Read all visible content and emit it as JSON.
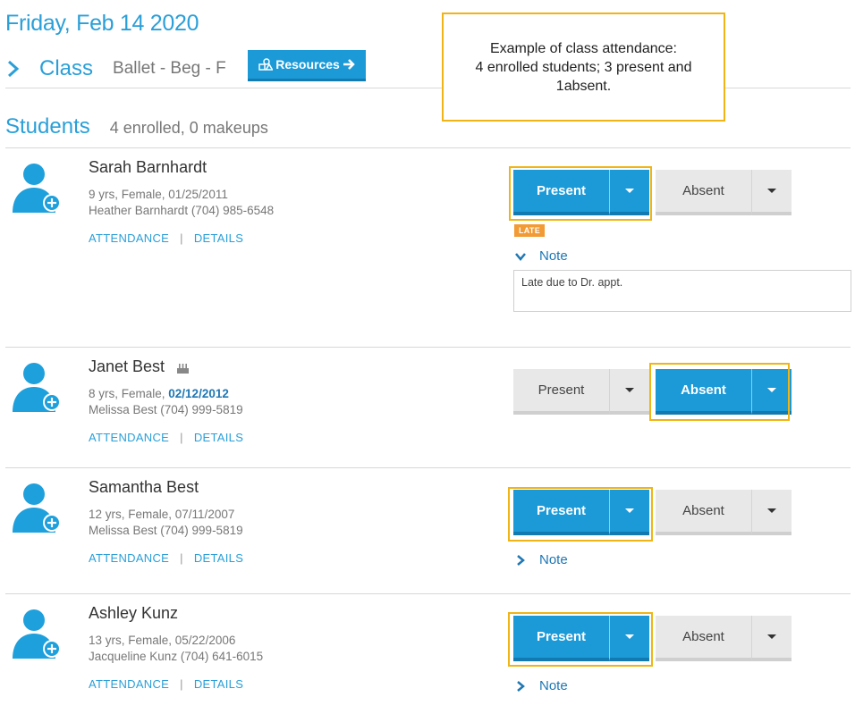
{
  "header": {
    "date": "Friday, Feb 14 2020",
    "class_label": "Class",
    "class_name": "Ballet - Beg - F",
    "resources_label": "Resources"
  },
  "students_section": {
    "title": "Students",
    "count_text": "4 enrolled, 0 makeups"
  },
  "callout": {
    "line1": "Example of class attendance:",
    "line2": "4 enrolled students; 3 present and",
    "line3": "1absent."
  },
  "links": {
    "attendance": "ATTENDANCE",
    "separator": "|",
    "details": "DETAILS"
  },
  "buttons": {
    "present": "Present",
    "absent": "Absent"
  },
  "note_label": "Note",
  "students": [
    {
      "name": "Sarah Barnhardt",
      "info_prefix": "9 yrs, Female, 01/25/2011",
      "dob_highlight": "",
      "guardian": "Heather Barnhardt (704) 985-6548",
      "status": "present",
      "badge": "LATE",
      "note_expanded": true,
      "note_text": "Late due to Dr. appt."
    },
    {
      "name": "Janet Best",
      "info_prefix": "8 yrs, Female, ",
      "dob_highlight": "02/12/2012",
      "guardian": "Melissa Best (704) 999-5819",
      "status": "absent",
      "birthday_icon": "birthday-cake-icon"
    },
    {
      "name": "Samantha Best",
      "info_prefix": "12 yrs, Female, 07/11/2007",
      "dob_highlight": "",
      "guardian": "Melissa Best (704) 999-5819",
      "status": "present",
      "note_expanded": false
    },
    {
      "name": "Ashley Kunz",
      "info_prefix": "13 yrs, Female, 05/22/2006",
      "dob_highlight": "",
      "guardian": "Jacqueline Kunz (704) 641-6015",
      "status": "present",
      "note_expanded": false
    }
  ],
  "colors": {
    "accent": "#1c9ad8",
    "highlight": "#f0b414",
    "late_badge": "#f29a33"
  }
}
